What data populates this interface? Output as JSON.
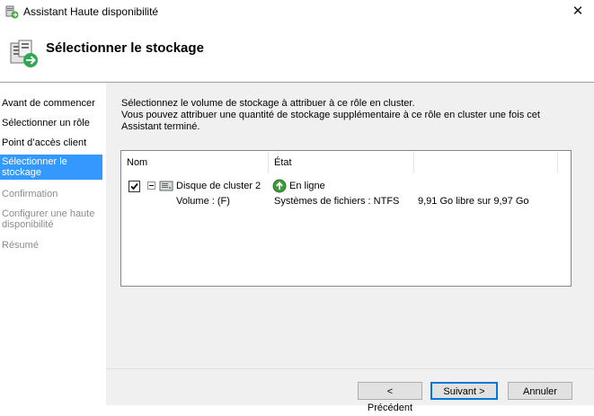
{
  "window": {
    "title": "Assistant Haute disponibilité",
    "close_glyph": "✕"
  },
  "header": {
    "title": "Sélectionner le stockage",
    "icon": "storage-wizard-icon"
  },
  "sidebar": {
    "items": [
      {
        "label": "Avant de commencer",
        "state": "normal"
      },
      {
        "label": "Sélectionner un rôle",
        "state": "normal"
      },
      {
        "label": "Point d’accès client",
        "state": "normal"
      },
      {
        "label": "Sélectionner le stockage",
        "state": "active"
      },
      {
        "label": "Confirmation",
        "state": "disabled"
      },
      {
        "label": "Configurer une haute disponibilité",
        "state": "disabled"
      },
      {
        "label": "Résumé",
        "state": "disabled"
      }
    ]
  },
  "instructions": {
    "line1": "Sélectionnez le volume de stockage à attribuer à ce rôle en cluster.",
    "line2": "Vous pouvez attribuer une quantité de stockage supplémentaire à ce rôle en cluster une fois cet",
    "line3": "Assistant terminé."
  },
  "table": {
    "columns": [
      "Nom",
      "État",
      ""
    ],
    "rows": [
      {
        "checked": true,
        "expanded": true,
        "name": "Disque de cluster 2",
        "status": "En ligne",
        "child": {
          "name": "Volume : (F)",
          "filesystem": "Systèmes de fichiers : NTFS",
          "space": "9,91 Go libre sur 9,97 Go"
        }
      }
    ]
  },
  "buttons": {
    "previous": "< Précédent",
    "next": "Suivant >",
    "cancel": "Annuler"
  },
  "colors": {
    "accent": "#3399ff",
    "online_green": "#3c9a3c",
    "default_button_border": "#0078d7"
  }
}
